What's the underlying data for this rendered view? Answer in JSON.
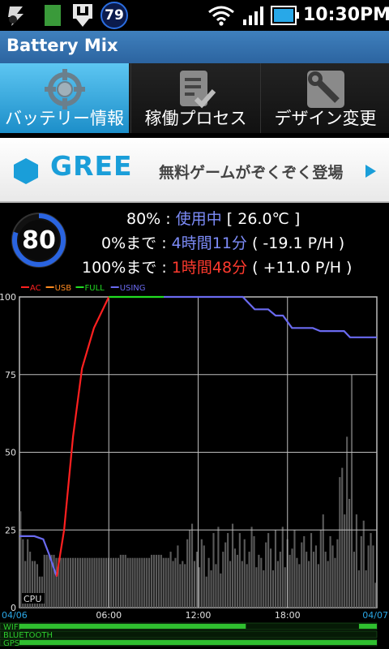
{
  "status_bar": {
    "battery_badge": "79",
    "time": "10:30PM",
    "icons": [
      "usb-debug-icon",
      "sd-card-icon",
      "download-icon",
      "battery-badge-icon",
      "wifi-icon",
      "signal-icon",
      "battery-icon"
    ]
  },
  "app": {
    "title": "Battery Mix"
  },
  "tabs": [
    {
      "label": "バッテリー情報",
      "icon": "target-icon",
      "active": true
    },
    {
      "label": "稼働プロセス",
      "icon": "checklist-icon",
      "active": false
    },
    {
      "label": "デザイン変更",
      "icon": "wrench-icon",
      "active": false
    }
  ],
  "ad": {
    "brand": "GREE",
    "message": "無料ゲームがぞくぞく登場"
  },
  "battery": {
    "level": "80",
    "percent_text": "80%",
    "sep": ":",
    "state": "使用中",
    "temp": "[ 26.0℃ ]",
    "to_empty_label": "0%まで",
    "to_empty_time": "4時間11分",
    "to_empty_rate": "( -19.1 P/H )",
    "to_full_label": "100%まで",
    "to_full_time": "1時間48分",
    "to_full_rate": "( +11.0 P/H )"
  },
  "chart_data": {
    "type": "line",
    "legend": [
      {
        "name": "AC",
        "color": "#ff2020"
      },
      {
        "name": "USB",
        "color": "#ff8a20"
      },
      {
        "name": "FULL",
        "color": "#22dd22"
      },
      {
        "name": "USING",
        "color": "#6a6af0"
      }
    ],
    "y_ticks": [
      "0",
      "25",
      "50",
      "75",
      "100"
    ],
    "ylim": [
      0,
      100
    ],
    "x_ticks": [
      "04/06",
      "06:00",
      "12:00",
      "18:00",
      "04/07"
    ],
    "xlim_hours": [
      0,
      24
    ],
    "cpu_label": "CPU",
    "bottom_bars": [
      {
        "name": "WIFI",
        "segments": [
          [
            0,
            15.2
          ],
          [
            22.8,
            24
          ]
        ]
      },
      {
        "name": "BLUETOOTH",
        "segments": []
      },
      {
        "name": "GPS",
        "segments": [
          [
            0,
            24
          ]
        ]
      }
    ],
    "battery_series": [
      {
        "status": "USING",
        "points": [
          [
            0,
            23
          ],
          [
            1.0,
            23
          ],
          [
            1.6,
            22
          ],
          [
            2.0,
            17
          ],
          [
            2.5,
            10
          ]
        ]
      },
      {
        "status": "AC",
        "points": [
          [
            2.5,
            10
          ],
          [
            3.0,
            25
          ],
          [
            3.6,
            55
          ],
          [
            4.2,
            77
          ],
          [
            5.0,
            90
          ],
          [
            6.0,
            100
          ]
        ]
      },
      {
        "status": "FULL",
        "points": [
          [
            6.0,
            100
          ],
          [
            7.7,
            100
          ],
          [
            9.7,
            100
          ]
        ]
      },
      {
        "status": "USING",
        "points": [
          [
            9.7,
            100
          ],
          [
            15.0,
            100
          ],
          [
            15.4,
            98
          ],
          [
            15.8,
            96
          ],
          [
            16.7,
            96
          ],
          [
            17.2,
            94
          ],
          [
            17.7,
            94
          ],
          [
            18.3,
            90
          ],
          [
            19.7,
            90
          ],
          [
            20.2,
            89
          ],
          [
            21.8,
            89
          ],
          [
            22.2,
            87
          ],
          [
            24,
            87
          ]
        ]
      }
    ],
    "cpu_values": [
      31,
      22,
      15,
      22,
      18,
      15,
      15,
      14,
      10,
      10,
      17,
      17,
      17,
      17,
      17,
      16,
      16,
      16,
      16,
      16,
      16,
      16,
      16,
      16,
      16,
      16,
      16,
      16,
      16,
      16,
      16,
      16,
      16,
      16,
      16,
      16,
      16,
      16,
      16,
      16,
      16,
      16,
      17,
      17,
      17,
      16,
      16,
      16,
      16,
      16,
      16,
      16,
      16,
      16,
      16,
      17,
      17,
      17,
      17,
      17,
      16,
      16,
      16,
      18,
      15,
      16,
      20,
      14,
      15,
      14,
      22,
      25,
      27,
      15,
      18,
      13,
      22,
      20,
      10,
      16,
      12,
      24,
      14,
      26,
      11,
      18,
      21,
      24,
      15,
      27,
      19,
      17,
      24,
      15,
      22,
      14,
      18,
      26,
      23,
      13,
      17,
      16,
      12,
      21,
      24,
      19,
      12,
      25,
      15,
      18,
      26,
      13,
      22,
      17,
      19,
      25,
      16,
      14,
      21,
      23,
      18,
      15,
      24,
      18,
      20,
      14,
      25,
      30,
      18,
      15,
      23,
      20,
      16,
      22,
      42,
      45,
      30,
      55,
      35,
      75,
      18,
      30,
      12,
      23,
      28,
      12,
      20,
      24,
      20,
      8
    ]
  }
}
